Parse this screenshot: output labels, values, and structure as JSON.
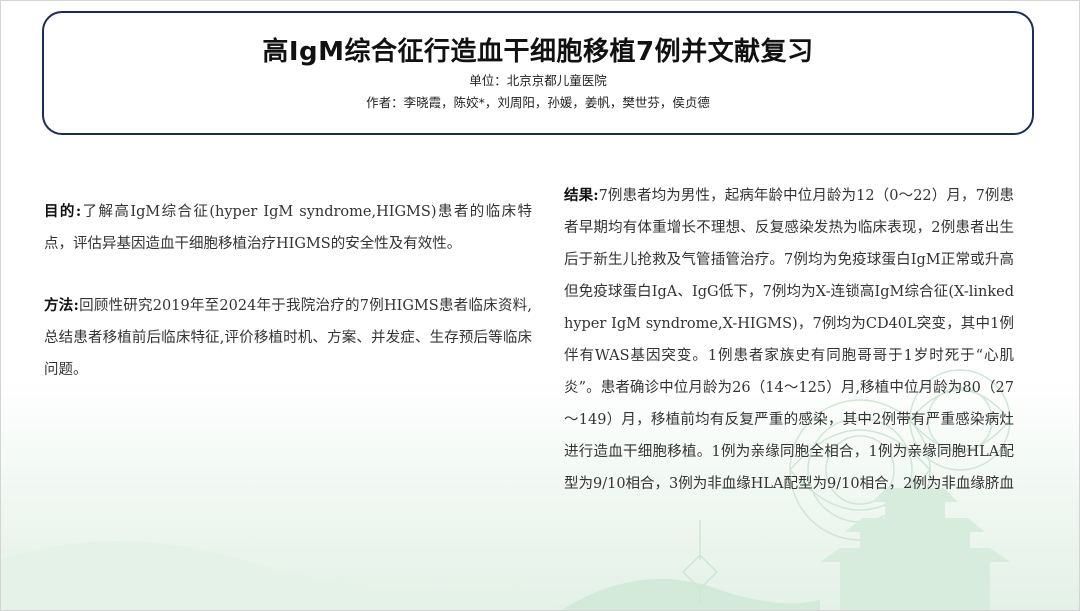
{
  "header": {
    "title": "高IgM综合征行造血干细胞移植7例并文献复习",
    "unit": "单位：北京京都儿童医院",
    "authors": "作者：李晓霞，陈姣*，刘周阳，孙媛，姜帆，樊世芬，侯贞德"
  },
  "purpose": {
    "label": "目的:",
    "text": "了解高IgM综合征(hyper IgM syndrome,HIGMS)患者的临床特点，评估异基因造血干细胞移植治疗HIGMS的安全性及有效性。"
  },
  "method": {
    "label": "方法:",
    "text": "回顾性研究2019年至2024年于我院治疗的7例HIGMS患者临床资料,总结患者移植前后临床特征,评价移植时机、方案、并发症、生存预后等临床问题。"
  },
  "results": {
    "label": "结果:",
    "text": "7例患者均为男性，起病年龄中位月龄为12（0～22）月，7例患者早期均有体重增长不理想、反复感染发热为临床表现，2例患者出生后于新生儿抢救及气管插管治疗。7例均为免疫球蛋白IgM正常或升高但免疫球蛋白IgA、IgG低下，7例均为X-连锁高IgM综合征(X-linked hyper IgM syndrome,X-HIGMS)，7例均为CD40L突变，其中1例伴有WAS基因突变。1例患者家族史有同胞哥哥于1岁时死于“心肌炎”。患者确诊中位月龄为26（14～125）月,移植中位月龄为80（27～149）月，移植前均有反复严重的感染，其中2例带有严重感染病灶进行造血干细胞移植。1例为亲缘同胞全相合，1例为亲缘同胞HLA配型为9/10相合，3例为非血缘HLA配型为9/10相合，2例为非血缘脐血"
  },
  "colors": {
    "box_border": "#1c2b5a",
    "decor_green": "#cfe6d6"
  }
}
